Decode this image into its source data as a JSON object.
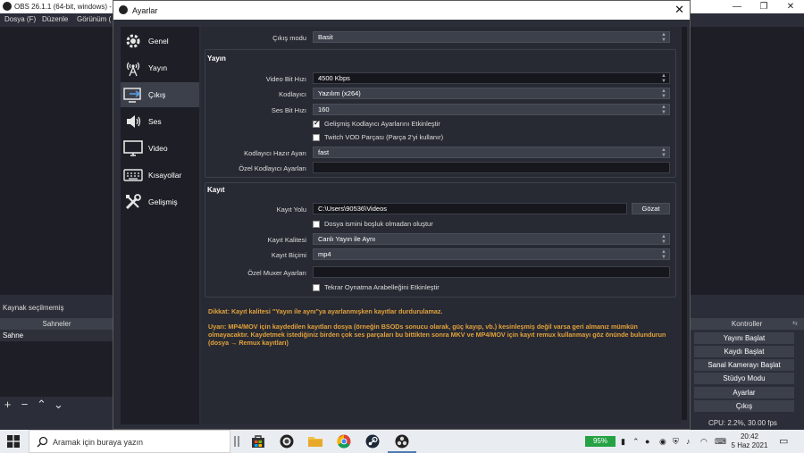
{
  "obs": {
    "title": "OBS 26.1.1 (64-bit, windows) - P",
    "menu": [
      "Dosya (F)",
      "Düzenle",
      "Görünüm ("
    ],
    "no_source_text": "Kaynak seçilmemiş",
    "scenes_header": "Sahneler",
    "scene_item": "Sahne",
    "controls_header": "Kontroller",
    "controls": [
      "Yayını Başlat",
      "Kaydı Başlat",
      "Sanal Kamerayı Başlat",
      "Stüdyo Modu",
      "Ayarlar",
      "Çıkış"
    ],
    "cpu_status": "CPU: 2.2%, 30.00 fps"
  },
  "dialog": {
    "title": "Ayarlar",
    "sidebar": [
      {
        "label": "Genel",
        "icon": "gear-icon"
      },
      {
        "label": "Yayın",
        "icon": "broadcast-icon"
      },
      {
        "label": "Çıkış",
        "icon": "output-icon"
      },
      {
        "label": "Ses",
        "icon": "speaker-icon"
      },
      {
        "label": "Video",
        "icon": "monitor-icon"
      },
      {
        "label": "Kısayollar",
        "icon": "keyboard-icon"
      },
      {
        "label": "Gelişmiş",
        "icon": "tools-icon"
      }
    ],
    "active_sidebar": "Çıkış",
    "output_mode": {
      "label": "Çıkış modu",
      "value": "Basit"
    },
    "streaming": {
      "title": "Yayın",
      "video_bitrate": {
        "label": "Video Bit Hızı",
        "value": "4500 Kbps"
      },
      "encoder": {
        "label": "Kodlayıcı",
        "value": "Yazılım (x264)"
      },
      "audio_bitrate": {
        "label": "Ses Bit Hızı",
        "value": "160"
      },
      "advanced_encoder": {
        "label": "Gelişmiş Kodlayıcı Ayarlarını Etkinleştir",
        "checked": true
      },
      "twitch_vod": {
        "label": "Twitch VOD Parçası (Parça 2'yi kullanır)",
        "checked": false
      },
      "encoder_preset": {
        "label": "Kodlayıcı Hazır Ayarı",
        "value": "fast"
      },
      "custom_encoder": {
        "label": "Özel Kodlayıcı Ayarları",
        "value": ""
      }
    },
    "recording": {
      "title": "Kayıt",
      "path": {
        "label": "Kayıt Yolu",
        "value": "C:\\Users\\90536\\Videos"
      },
      "browse": "Gözat",
      "no_space": {
        "label": "Dosya ismini boşluk olmadan oluştur",
        "checked": false
      },
      "quality": {
        "label": "Kayıt Kalitesi",
        "value": "Canlı Yayın ile Aynı"
      },
      "format": {
        "label": "Kayıt Biçimi",
        "value": "mp4"
      },
      "muxer": {
        "label": "Özel Muxer Ayarları",
        "value": ""
      },
      "replay_buffer": {
        "label": "Tekrar Oynatma Arabelleğini Etkinleştir",
        "checked": false
      }
    },
    "warning1": "Dikkat: Kayıt kalitesi \"Yayın ile aynı\"ya ayarlanmışken kayıtlar durdurulamaz.",
    "warning2": "Uyarı: MP4/MOV için kaydedilen kayıtları dosya (örneğin BSODs sonucu olarak, güç kayıp, vb.) kesinleşmiş değil varsa geri almanız mümkün olmayacaktır. Kaydetmek istediğiniz birden çok ses parçaları bu bittikten sonra MKV ve MP4/MOV için kayıt remux kullanmayı göz önünde bulundurun (dosya → Remux kayıtları)"
  },
  "taskbar": {
    "search_placeholder": "Aramak için buraya yazın",
    "battery": "95%",
    "time": "20:42",
    "date": "5 Haz 2021",
    "accent": "#25a244"
  }
}
